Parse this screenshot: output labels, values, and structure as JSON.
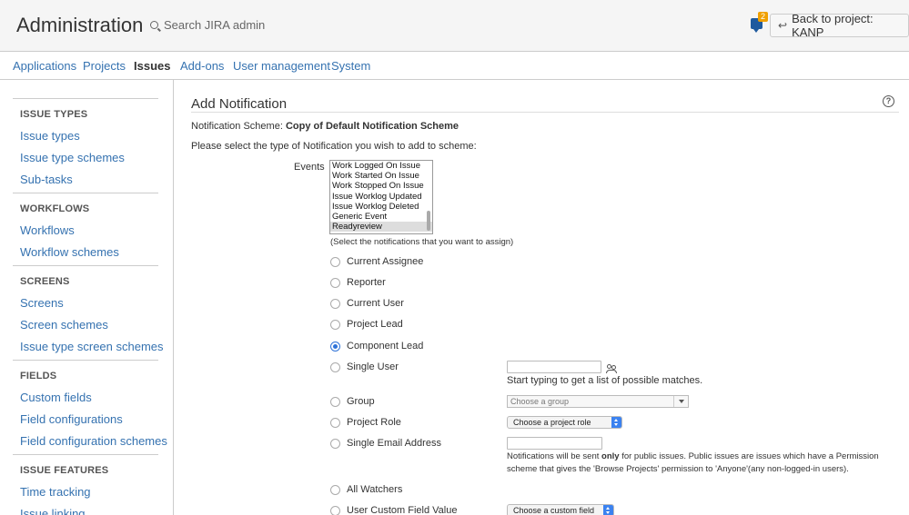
{
  "header": {
    "title": "Administration",
    "search_placeholder": "Search JIRA admin",
    "notification_count": "2",
    "back_button_label": "Back to project: KANP"
  },
  "nav": {
    "tabs": [
      {
        "label": "Applications",
        "active": false
      },
      {
        "label": "Projects",
        "active": false
      },
      {
        "label": "Issues",
        "active": true
      },
      {
        "label": "Add-ons",
        "active": false
      },
      {
        "label": "User management",
        "active": false
      },
      {
        "label": "System",
        "active": false
      }
    ]
  },
  "sidebar": {
    "sections": [
      {
        "heading": "ISSUE TYPES",
        "items": [
          "Issue types",
          "Issue type schemes",
          "Sub-tasks"
        ]
      },
      {
        "heading": "WORKFLOWS",
        "items": [
          "Workflows",
          "Workflow schemes"
        ]
      },
      {
        "heading": "SCREENS",
        "items": [
          "Screens",
          "Screen schemes",
          "Issue type screen schemes"
        ]
      },
      {
        "heading": "FIELDS",
        "items": [
          "Custom fields",
          "Field configurations",
          "Field configuration schemes"
        ]
      },
      {
        "heading": "ISSUE FEATURES",
        "items": [
          "Time tracking",
          "Issue linking"
        ]
      }
    ]
  },
  "main": {
    "heading": "Add Notification",
    "scheme_label": "Notification Scheme:",
    "scheme_name": "Copy of Default Notification Scheme",
    "instruction": "Please select the type of Notification you wish to add to scheme:",
    "events_label": "Events",
    "events_options": [
      {
        "label": "Work Logged On Issue",
        "selected": false
      },
      {
        "label": "Work Started On Issue",
        "selected": false
      },
      {
        "label": "Work Stopped On Issue",
        "selected": false
      },
      {
        "label": "Issue Worklog Updated",
        "selected": false
      },
      {
        "label": "Issue Worklog Deleted",
        "selected": false
      },
      {
        "label": "Generic Event",
        "selected": false
      },
      {
        "label": "Readyreview",
        "selected": true
      }
    ],
    "events_hint": "(Select the notifications that you want to assign)",
    "recipient_types": [
      {
        "label": "Current Assignee",
        "checked": false
      },
      {
        "label": "Reporter",
        "checked": false
      },
      {
        "label": "Current User",
        "checked": false
      },
      {
        "label": "Project Lead",
        "checked": false
      },
      {
        "label": "Component Lead",
        "checked": true
      },
      {
        "label": "Single User",
        "checked": false
      },
      {
        "label": "Group",
        "checked": false
      },
      {
        "label": "Project Role",
        "checked": false
      },
      {
        "label": "Single Email Address",
        "checked": false
      },
      {
        "label": "All Watchers",
        "checked": false
      },
      {
        "label": "User Custom Field Value",
        "checked": false
      }
    ],
    "single_user_hint": "Start typing to get a list of possible matches.",
    "group_placeholder": "Choose a group",
    "project_role_value": "Choose a project role",
    "email_hint_pre": "Notifications will be sent ",
    "email_hint_bold": "only",
    "email_hint_post": " for public issues. Public issues are issues which have a Permission scheme that gives the 'Browse Projects' permission to 'Anyone'(any non-logged-in users).",
    "custom_field_value": "Choose a custom field"
  },
  "colors": {
    "link": "#3572b0",
    "accent_radio": "#2f73d8",
    "header_bg": "#f5f5f5",
    "badge": "#f0a000"
  }
}
